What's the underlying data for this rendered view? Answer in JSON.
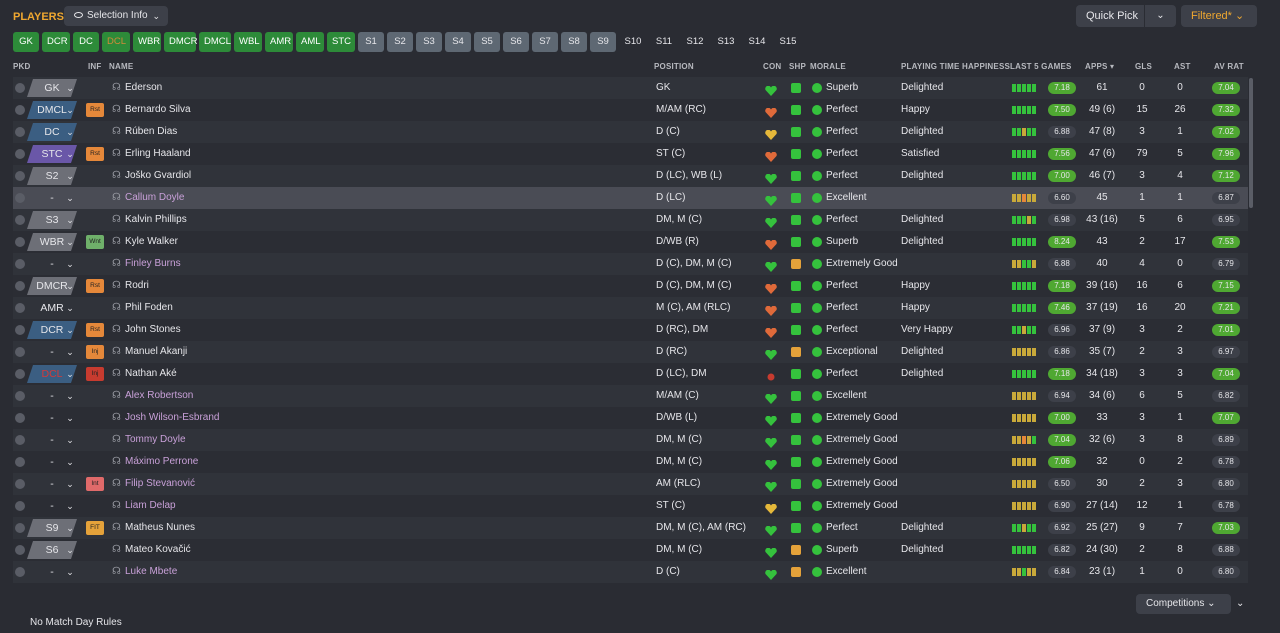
{
  "header": {
    "title": "PLAYERS",
    "selection_info": "Selection Info",
    "quick_pick": "Quick Pick",
    "filtered": "Filtered*",
    "competitions": "Competitions",
    "footer": "No Match Day Rules"
  },
  "positions": [
    {
      "label": "GK",
      "style": "green"
    },
    {
      "label": "DCR",
      "style": "green"
    },
    {
      "label": "DC",
      "style": "green"
    },
    {
      "label": "DCL",
      "style": "green dim"
    },
    {
      "label": "WBR",
      "style": "green"
    },
    {
      "label": "DMCR",
      "style": "green"
    },
    {
      "label": "DMCL",
      "style": "green"
    },
    {
      "label": "WBL",
      "style": "green"
    },
    {
      "label": "AMR",
      "style": "green"
    },
    {
      "label": "AML",
      "style": "green"
    },
    {
      "label": "STC",
      "style": "green"
    },
    {
      "label": "S1",
      "style": "grey"
    },
    {
      "label": "S2",
      "style": "grey"
    },
    {
      "label": "S3",
      "style": "grey"
    },
    {
      "label": "S4",
      "style": "grey"
    },
    {
      "label": "S5",
      "style": "grey"
    },
    {
      "label": "S6",
      "style": "grey"
    },
    {
      "label": "S7",
      "style": "grey"
    },
    {
      "label": "S8",
      "style": "grey"
    },
    {
      "label": "S9",
      "style": "grey"
    },
    {
      "label": "S10",
      "style": "plain"
    },
    {
      "label": "S11",
      "style": "plain"
    },
    {
      "label": "S12",
      "style": "plain"
    },
    {
      "label": "S13",
      "style": "plain"
    },
    {
      "label": "S14",
      "style": "plain"
    },
    {
      "label": "S15",
      "style": "plain"
    }
  ],
  "columns": {
    "pkd": "PKD",
    "inf": "INF",
    "name": "NAME",
    "position": "POSITION",
    "con": "CON",
    "shp": "SHP",
    "morale": "MORALE",
    "pth": "PLAYING TIME HAPPINESS",
    "last5": "LAST 5 GAMES",
    "apps": "APPS",
    "gls": "GLS",
    "ast": "AST",
    "avrat": "AV RAT"
  },
  "colors": {
    "green": "#35c23d",
    "amber": "#e5a23a",
    "red": "#c73b2f",
    "slate": "#3b5e82",
    "purple": "#6a57a8",
    "grey_tag": "#6d6f77"
  },
  "players": [
    {
      "pkd": "GK",
      "pkd_color": "#6d6f77",
      "inf": "",
      "inf_color": "",
      "name": "Ederson",
      "pink": false,
      "position": "GK",
      "con": "green",
      "shp": "green",
      "morale": "Superb",
      "pth": "Delighted",
      "form": [
        "#35c23d",
        "#35c23d",
        "#35c23d",
        "#35c23d",
        "#35c23d"
      ],
      "last_rating": "7.18",
      "lr_color": "#4fa832",
      "apps": "61",
      "gls": "0",
      "ast": "0",
      "avr": "7.04",
      "avr_color": "#4fa832"
    },
    {
      "pkd": "DMCL",
      "pkd_color": "#3b5e82",
      "inf": "Rst",
      "inf_color": "#e5883a",
      "name": "Bernardo Silva",
      "pink": false,
      "position": "M/AM (RC)",
      "con": "orange",
      "shp": "green",
      "morale": "Perfect",
      "pth": "Happy",
      "form": [
        "#35c23d",
        "#35c23d",
        "#35c23d",
        "#35c23d",
        "#35c23d"
      ],
      "last_rating": "7.50",
      "lr_color": "#4fa832",
      "apps": "49 (6)",
      "gls": "15",
      "ast": "26",
      "avr": "7.32",
      "avr_color": "#4fa832"
    },
    {
      "pkd": "DC",
      "pkd_color": "#3b5e82",
      "inf": "",
      "inf_color": "",
      "name": "Rúben Dias",
      "pink": false,
      "position": "D (C)",
      "con": "amber",
      "shp": "green",
      "morale": "Perfect",
      "pth": "Delighted",
      "form": [
        "#35c23d",
        "#35c23d",
        "#c9a93a",
        "#35c23d",
        "#35c23d"
      ],
      "last_rating": "6.88",
      "lr_color": "#3d4049",
      "apps": "47 (8)",
      "gls": "3",
      "ast": "1",
      "avr": "7.02",
      "avr_color": "#4fa832"
    },
    {
      "pkd": "STC",
      "pkd_color": "#6a57a8",
      "inf": "Rst",
      "inf_color": "#e5883a",
      "name": "Erling Haaland",
      "pink": false,
      "position": "ST (C)",
      "con": "orange",
      "shp": "green",
      "morale": "Perfect",
      "pth": "Satisfied",
      "form": [
        "#35c23d",
        "#35c23d",
        "#35c23d",
        "#35c23d",
        "#35c23d"
      ],
      "last_rating": "7.56",
      "lr_color": "#4fa832",
      "apps": "47 (6)",
      "gls": "79",
      "ast": "5",
      "avr": "7.96",
      "avr_color": "#4fa832"
    },
    {
      "pkd": "S2",
      "pkd_color": "#6d6f77",
      "inf": "",
      "inf_color": "",
      "name": "Joško Gvardiol",
      "pink": false,
      "position": "D (LC), WB (L)",
      "con": "green",
      "shp": "green",
      "morale": "Perfect",
      "pth": "Delighted",
      "form": [
        "#35c23d",
        "#35c23d",
        "#35c23d",
        "#35c23d",
        "#35c23d"
      ],
      "last_rating": "7.00",
      "lr_color": "#4fa832",
      "apps": "46 (7)",
      "gls": "3",
      "ast": "4",
      "avr": "7.12",
      "avr_color": "#4fa832"
    },
    {
      "pkd": "-",
      "pkd_color": "none",
      "inf": "",
      "inf_color": "",
      "name": "Callum Doyle",
      "pink": true,
      "position": "D (LC)",
      "con": "green",
      "shp": "green",
      "morale": "Excellent",
      "pth": "",
      "form": [
        "#c9a93a",
        "#c9a93a",
        "#e5883a",
        "#c9a93a",
        "#c9a93a"
      ],
      "last_rating": "6.60",
      "lr_color": "#3d4049",
      "apps": "45",
      "gls": "1",
      "ast": "1",
      "avr": "6.87",
      "avr_color": "#3d4049"
    },
    {
      "pkd": "S3",
      "pkd_color": "#6d6f77",
      "inf": "",
      "inf_color": "",
      "name": "Kalvin Phillips",
      "pink": false,
      "position": "DM, M (C)",
      "con": "green",
      "shp": "green",
      "morale": "Perfect",
      "pth": "Delighted",
      "form": [
        "#35c23d",
        "#35c23d",
        "#35c23d",
        "#c9a93a",
        "#35c23d"
      ],
      "last_rating": "6.98",
      "lr_color": "#3d4049",
      "apps": "43 (16)",
      "gls": "5",
      "ast": "6",
      "avr": "6.95",
      "avr_color": "#3d4049"
    },
    {
      "pkd": "WBR",
      "pkd_color": "#6d6f77",
      "inf": "Wnt",
      "inf_color": "#6fb06a",
      "name": "Kyle Walker",
      "pink": false,
      "position": "D/WB (R)",
      "con": "orange",
      "shp": "green",
      "morale": "Superb",
      "pth": "Delighted",
      "form": [
        "#35c23d",
        "#35c23d",
        "#35c23d",
        "#35c23d",
        "#35c23d"
      ],
      "last_rating": "8.24",
      "lr_color": "#4fa832",
      "apps": "43",
      "gls": "2",
      "ast": "17",
      "avr": "7.53",
      "avr_color": "#4fa832"
    },
    {
      "pkd": "-",
      "pkd_color": "none",
      "inf": "",
      "inf_color": "",
      "name": "Finley Burns",
      "pink": true,
      "position": "D (C), DM, M (C)",
      "con": "green",
      "shp": "amberbar",
      "morale": "Extremely Good",
      "pth": "",
      "form": [
        "#c9a93a",
        "#c9a93a",
        "#35c23d",
        "#35c23d",
        "#c9a93a"
      ],
      "last_rating": "6.88",
      "lr_color": "#3d4049",
      "apps": "40",
      "gls": "4",
      "ast": "0",
      "avr": "6.79",
      "avr_color": "#3d4049"
    },
    {
      "pkd": "DMCR",
      "pkd_color": "#6d6f77",
      "inf": "Rst",
      "inf_color": "#e5883a",
      "name": "Rodri",
      "pink": false,
      "position": "D (C), DM, M (C)",
      "con": "orange",
      "shp": "green",
      "morale": "Perfect",
      "pth": "Happy",
      "form": [
        "#35c23d",
        "#35c23d",
        "#35c23d",
        "#35c23d",
        "#35c23d"
      ],
      "last_rating": "7.18",
      "lr_color": "#4fa832",
      "apps": "39 (16)",
      "gls": "16",
      "ast": "6",
      "avr": "7.15",
      "avr_color": "#4fa832"
    },
    {
      "pkd": "AMR",
      "pkd_color": "none",
      "inf": "",
      "inf_color": "",
      "name": "Phil Foden",
      "pink": false,
      "position": "M (C), AM (RLC)",
      "con": "orange",
      "shp": "green",
      "morale": "Perfect",
      "pth": "Happy",
      "form": [
        "#35c23d",
        "#35c23d",
        "#35c23d",
        "#35c23d",
        "#35c23d"
      ],
      "last_rating": "7.46",
      "lr_color": "#4fa832",
      "apps": "37 (19)",
      "gls": "16",
      "ast": "20",
      "avr": "7.21",
      "avr_color": "#4fa832"
    },
    {
      "pkd": "DCR",
      "pkd_color": "#3b5e82",
      "inf": "Rst",
      "inf_color": "#e5883a",
      "name": "John Stones",
      "pink": false,
      "position": "D (RC), DM",
      "con": "orange",
      "shp": "green",
      "morale": "Perfect",
      "pth": "Very Happy",
      "form": [
        "#35c23d",
        "#35c23d",
        "#c9a93a",
        "#35c23d",
        "#35c23d"
      ],
      "last_rating": "6.96",
      "lr_color": "#3d4049",
      "apps": "37 (9)",
      "gls": "3",
      "ast": "2",
      "avr": "7.01",
      "avr_color": "#4fa832"
    },
    {
      "pkd": "-",
      "pkd_color": "none",
      "inf": "Inj",
      "inf_color": "#e5883a",
      "name": "Manuel Akanji",
      "pink": false,
      "position": "D (RC)",
      "con": "green",
      "shp": "amber",
      "morale": "Exceptional",
      "pth": "Delighted",
      "form": [
        "#c9a93a",
        "#c9a93a",
        "#c9a93a",
        "#c9a93a",
        "#c9a93a"
      ],
      "last_rating": "6.86",
      "lr_color": "#3d4049",
      "apps": "35 (7)",
      "gls": "2",
      "ast": "3",
      "avr": "6.97",
      "avr_color": "#3d4049"
    },
    {
      "pkd": "DCL",
      "pkd_color": "#3b5e82",
      "inf": "Inj",
      "inf_color": "#c73b2f",
      "name": "Nathan Aké",
      "pink": false,
      "position": "D (LC), DM",
      "con": "red",
      "shp": "green",
      "morale": "Perfect",
      "pth": "Delighted",
      "form": [
        "#35c23d",
        "#35c23d",
        "#35c23d",
        "#35c23d",
        "#35c23d"
      ],
      "last_rating": "7.18",
      "lr_color": "#4fa832",
      "apps": "34 (18)",
      "gls": "3",
      "ast": "3",
      "avr": "7.04",
      "avr_color": "#4fa832"
    },
    {
      "pkd": "-",
      "pkd_color": "none",
      "inf": "",
      "inf_color": "",
      "name": "Alex Robertson",
      "pink": true,
      "position": "M/AM (C)",
      "con": "green",
      "shp": "greenbar",
      "morale": "Excellent",
      "pth": "",
      "form": [
        "#c9a93a",
        "#c9a93a",
        "#c9a93a",
        "#c9a93a",
        "#c9a93a"
      ],
      "last_rating": "6.94",
      "lr_color": "#3d4049",
      "apps": "34 (6)",
      "gls": "6",
      "ast": "5",
      "avr": "6.82",
      "avr_color": "#3d4049"
    },
    {
      "pkd": "-",
      "pkd_color": "none",
      "inf": "",
      "inf_color": "",
      "name": "Josh Wilson-Esbrand",
      "pink": true,
      "position": "D/WB (L)",
      "con": "green",
      "shp": "greenbar",
      "morale": "Extremely Good",
      "pth": "",
      "form": [
        "#c9a93a",
        "#c9a93a",
        "#c9a93a",
        "#c9a93a",
        "#c9a93a"
      ],
      "last_rating": "7.00",
      "lr_color": "#4fa832",
      "apps": "33",
      "gls": "3",
      "ast": "1",
      "avr": "7.07",
      "avr_color": "#4fa832"
    },
    {
      "pkd": "-",
      "pkd_color": "none",
      "inf": "",
      "inf_color": "",
      "name": "Tommy Doyle",
      "pink": true,
      "position": "DM, M (C)",
      "con": "green",
      "shp": "greenbar",
      "morale": "Extremely Good",
      "pth": "",
      "form": [
        "#c9a93a",
        "#c9a93a",
        "#e5883a",
        "#c9a93a",
        "#35c23d"
      ],
      "last_rating": "7.04",
      "lr_color": "#4fa832",
      "apps": "32 (6)",
      "gls": "3",
      "ast": "8",
      "avr": "6.89",
      "avr_color": "#3d4049"
    },
    {
      "pkd": "-",
      "pkd_color": "none",
      "inf": "",
      "inf_color": "",
      "name": "Máximo Perrone",
      "pink": true,
      "position": "DM, M (C)",
      "con": "green",
      "shp": "greenbar",
      "morale": "Extremely Good",
      "pth": "",
      "form": [
        "#c9a93a",
        "#c9a93a",
        "#c9a93a",
        "#c9a93a",
        "#c9a93a"
      ],
      "last_rating": "7.06",
      "lr_color": "#4fa832",
      "apps": "32",
      "gls": "0",
      "ast": "2",
      "avr": "6.78",
      "avr_color": "#3d4049"
    },
    {
      "pkd": "-",
      "pkd_color": "none",
      "inf": "Int",
      "inf_color": "#e06a6a",
      "name": "Filip Stevanović",
      "pink": true,
      "position": "AM (RLC)",
      "con": "green",
      "shp": "greenbar",
      "morale": "Extremely Good",
      "pth": "",
      "form": [
        "#c9a93a",
        "#c9a93a",
        "#c9a93a",
        "#c9a93a",
        "#c9a93a"
      ],
      "last_rating": "6.50",
      "lr_color": "#3d4049",
      "apps": "30",
      "gls": "2",
      "ast": "3",
      "avr": "6.80",
      "avr_color": "#3d4049"
    },
    {
      "pkd": "-",
      "pkd_color": "none",
      "inf": "",
      "inf_color": "",
      "name": "Liam Delap",
      "pink": true,
      "position": "ST (C)",
      "con": "amber",
      "shp": "greenbar",
      "morale": "Extremely Good",
      "pth": "",
      "form": [
        "#c9a93a",
        "#c9a93a",
        "#c9a93a",
        "#c9a93a",
        "#c9a93a"
      ],
      "last_rating": "6.90",
      "lr_color": "#3d4049",
      "apps": "27 (14)",
      "gls": "12",
      "ast": "1",
      "avr": "6.78",
      "avr_color": "#3d4049"
    },
    {
      "pkd": "S9",
      "pkd_color": "#6d6f77",
      "inf": "FIT",
      "inf_color": "#e5a23a",
      "name": "Matheus Nunes",
      "pink": false,
      "position": "DM, M (C), AM (RC)",
      "con": "green",
      "shp": "green",
      "morale": "Perfect",
      "pth": "Delighted",
      "form": [
        "#35c23d",
        "#35c23d",
        "#c9a93a",
        "#35c23d",
        "#35c23d"
      ],
      "last_rating": "6.92",
      "lr_color": "#3d4049",
      "apps": "25 (27)",
      "gls": "9",
      "ast": "7",
      "avr": "7.03",
      "avr_color": "#4fa832"
    },
    {
      "pkd": "S6",
      "pkd_color": "#6d6f77",
      "inf": "",
      "inf_color": "",
      "name": "Mateo Kovačić",
      "pink": false,
      "position": "DM, M (C)",
      "con": "green",
      "shp": "amber",
      "morale": "Superb",
      "pth": "Delighted",
      "form": [
        "#35c23d",
        "#35c23d",
        "#35c23d",
        "#35c23d",
        "#35c23d"
      ],
      "last_rating": "6.82",
      "lr_color": "#3d4049",
      "apps": "24 (30)",
      "gls": "2",
      "ast": "8",
      "avr": "6.88",
      "avr_color": "#3d4049"
    },
    {
      "pkd": "-",
      "pkd_color": "none",
      "inf": "",
      "inf_color": "",
      "name": "Luke Mbete",
      "pink": true,
      "position": "D (C)",
      "con": "green",
      "shp": "amberbar",
      "morale": "Excellent",
      "pth": "",
      "form": [
        "#c9a93a",
        "#c9a93a",
        "#35c23d",
        "#c9a93a",
        "#c9a93a"
      ],
      "last_rating": "6.84",
      "lr_color": "#3d4049",
      "apps": "23 (1)",
      "gls": "1",
      "ast": "0",
      "avr": "6.80",
      "avr_color": "#3d4049"
    }
  ]
}
